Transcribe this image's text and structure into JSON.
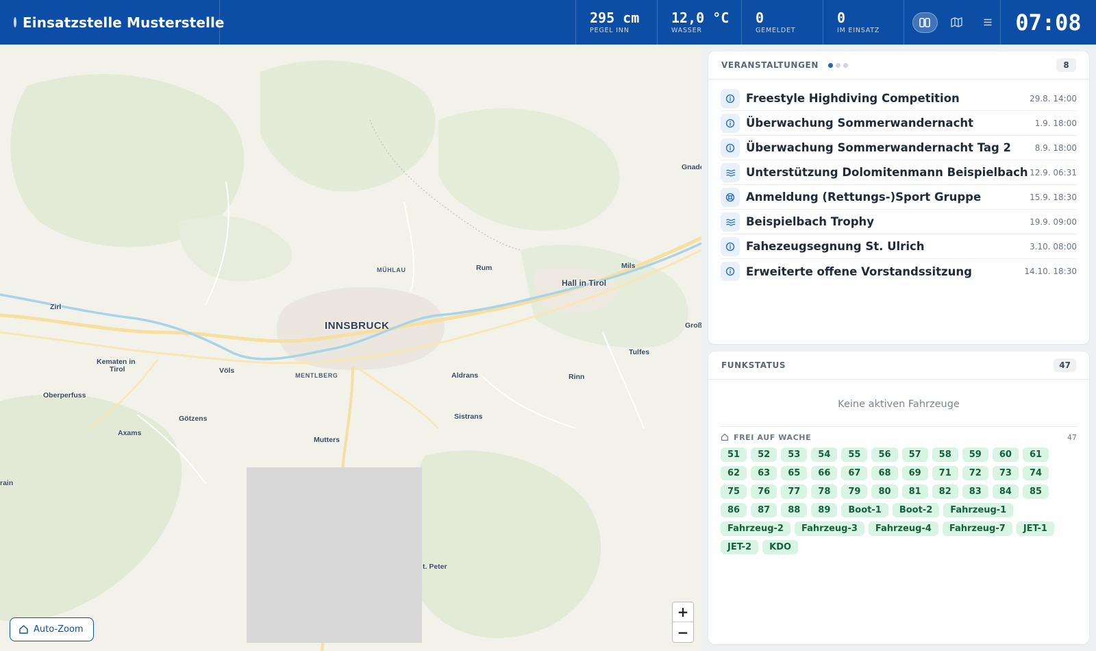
{
  "header": {
    "title": "Einsatzstelle Musterstelle",
    "stats": [
      {
        "value": "295 cm",
        "label": "PEGEL INN"
      },
      {
        "value": "12,0 °C",
        "label": "WASSER"
      },
      {
        "value": "0",
        "label": "GEMELDET"
      },
      {
        "value": "0",
        "label": "IM EINSATZ"
      }
    ],
    "view_buttons": [
      "split-view-icon",
      "map-view-icon",
      "list-view-icon"
    ],
    "active_view": "split",
    "clock": "07:08"
  },
  "map": {
    "labels": {
      "innsbruck": "INNSBRUCK",
      "muehlau": "MÜHLAU",
      "mentlberg": "MENTLBERG",
      "rum": "Rum",
      "mils": "Mils",
      "hall": "Hall in Tirol",
      "zirl": "Zirl",
      "kematen": "Kematen in",
      "tirol": "Tirol",
      "voels": "Völs",
      "oberperfuss": "Oberperfuss",
      "goetzens": "Götzens",
      "axams": "Axams",
      "mutters": "Mutters",
      "aldrans": "Aldrans",
      "sistrans": "Sistrans",
      "rinn": "Rinn",
      "tulfes": "Tulfes",
      "gnade": "Gnade",
      "gross": "Groß",
      "rain": "rain",
      "stpeter": "t. Peter"
    },
    "zoom_in": "+",
    "zoom_out": "−",
    "auto_zoom_label": "Auto-Zoom"
  },
  "events_panel": {
    "title": "VERANSTALTUNGEN",
    "count": "8",
    "events": [
      {
        "icon": "info-icon",
        "name": "Freestyle Highdiving Competition",
        "date": "29.8. 14:00"
      },
      {
        "icon": "info-icon",
        "name": "Überwachung Sommerwandernacht",
        "date": "1.9. 18:00"
      },
      {
        "icon": "info-icon",
        "name": "Überwachung Sommerwandernacht Tag 2",
        "date": "8.9. 18:00"
      },
      {
        "icon": "waves-icon",
        "name": "Unterstützung Dolomitenmann Beispielbach",
        "date": "12.9. 06:31"
      },
      {
        "icon": "lifebuoy-icon",
        "name": "Anmeldung (Rettungs-)Sport Gruppe",
        "date": "15.9. 18:30"
      },
      {
        "icon": "waves-icon",
        "name": "Beispielbach Trophy",
        "date": "19.9. 09:00"
      },
      {
        "icon": "info-icon",
        "name": "Fahezeugsegnung St. Ulrich",
        "date": "3.10. 08:00"
      },
      {
        "icon": "info-icon",
        "name": "Erweiterte offene Vorstandssitzung",
        "date": "14.10. 18:30"
      }
    ]
  },
  "radio_panel": {
    "title": "FUNKSTATUS",
    "count": "47",
    "empty_text": "Keine aktiven Fahrzeuge",
    "station": {
      "title": "FREI AUF WACHE",
      "count": "47",
      "vehicles": [
        "51",
        "52",
        "53",
        "54",
        "55",
        "56",
        "57",
        "58",
        "59",
        "60",
        "61",
        "62",
        "63",
        "65",
        "66",
        "67",
        "68",
        "69",
        "71",
        "72",
        "73",
        "74",
        "75",
        "76",
        "77",
        "78",
        "79",
        "80",
        "81",
        "82",
        "83",
        "84",
        "85",
        "86",
        "87",
        "88",
        "89",
        "Boot-1",
        "Boot-2",
        "Fahrzeug-1",
        "Fahrzeug-2",
        "Fahrzeug-3",
        "Fahrzeug-4",
        "Fahrzeug-7",
        "JET-1",
        "JET-2",
        "KDO"
      ]
    }
  },
  "colors": {
    "header_bg": "#0c4ea6",
    "accent_blue": "#1b66c9",
    "chip_bg": "#d8f5e4",
    "chip_text": "#15603b"
  }
}
